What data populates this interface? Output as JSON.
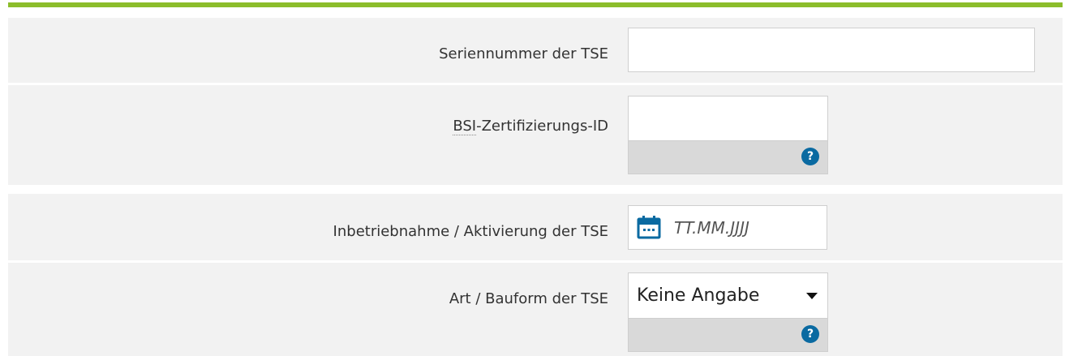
{
  "colors": {
    "accent": "#8cbd2b",
    "row_background": "#f2f2f2",
    "help_panel": "#d9d9d9",
    "help_icon": "#0a6aa1",
    "calendar_icon": "#0a6aa1"
  },
  "form": {
    "serial_number": {
      "label": "Seriennummer der TSE",
      "value": ""
    },
    "bsi_id": {
      "label_abbr": "BSI",
      "label_rest": "-Zertifizierungs-ID",
      "value": "",
      "help_icon_text": "?"
    },
    "activation_date": {
      "label": "Inbetriebnahme / Aktivierung der TSE",
      "placeholder": "TT.MM.JJJJ",
      "icon": "calendar-icon"
    },
    "tse_type": {
      "label": "Art / Bauform der TSE",
      "selected": "Keine Angabe",
      "help_icon_text": "?"
    }
  }
}
